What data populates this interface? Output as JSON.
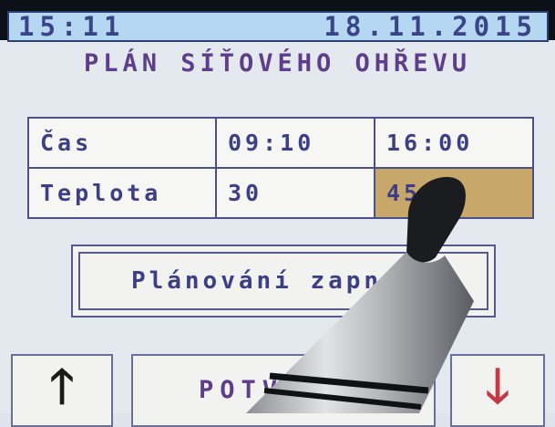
{
  "status": {
    "time": "15:11",
    "date": "18.11.2015"
  },
  "title": "PLÁN SÍŤOVÉHO OHŘEVU",
  "schedule": {
    "rows": [
      {
        "label": "Čas",
        "c1": "09:10",
        "c2": "16:00"
      },
      {
        "label": "Teplota",
        "c1": "30",
        "c2": "45"
      }
    ]
  },
  "planning_button": {
    "label": "Plánování zapnuto"
  },
  "nav": {
    "up_icon": "arrow-up-icon",
    "middle_label": "POTVRDIT",
    "down_icon": "arrow-down-icon"
  },
  "colors": {
    "status_bar": "#b6d7f1",
    "highlight_cell": "#c8a76a",
    "text": "#3c3f86",
    "down_arrow": "#c43a44"
  }
}
